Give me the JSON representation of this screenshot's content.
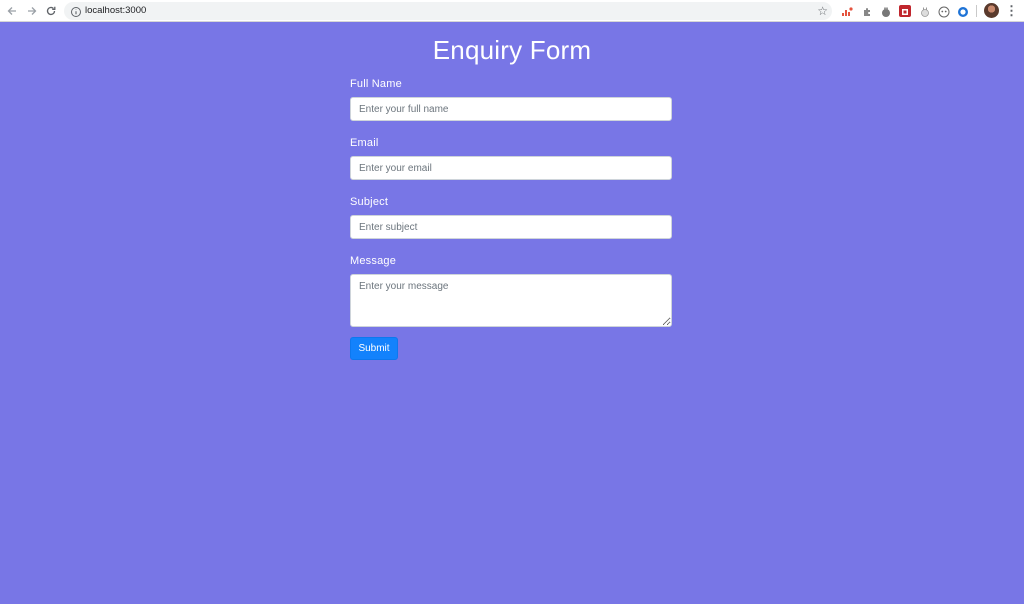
{
  "browser": {
    "url": "localhost:3000",
    "back_icon": "arrow-left-icon",
    "forward_icon": "arrow-right-icon",
    "reload_icon": "reload-icon",
    "star_icon": "star-icon",
    "menu_icon": "more-vert-icon"
  },
  "page": {
    "title": "Enquiry Form"
  },
  "form": {
    "full_name": {
      "label": "Full Name",
      "placeholder": "Enter your full name"
    },
    "email": {
      "label": "Email",
      "placeholder": "Enter your email"
    },
    "subject": {
      "label": "Subject",
      "placeholder": "Enter subject"
    },
    "message": {
      "label": "Message",
      "placeholder": "Enter your message"
    },
    "submit_label": "Submit"
  },
  "colors": {
    "background": "#7876e6",
    "submit": "#1382fc"
  }
}
